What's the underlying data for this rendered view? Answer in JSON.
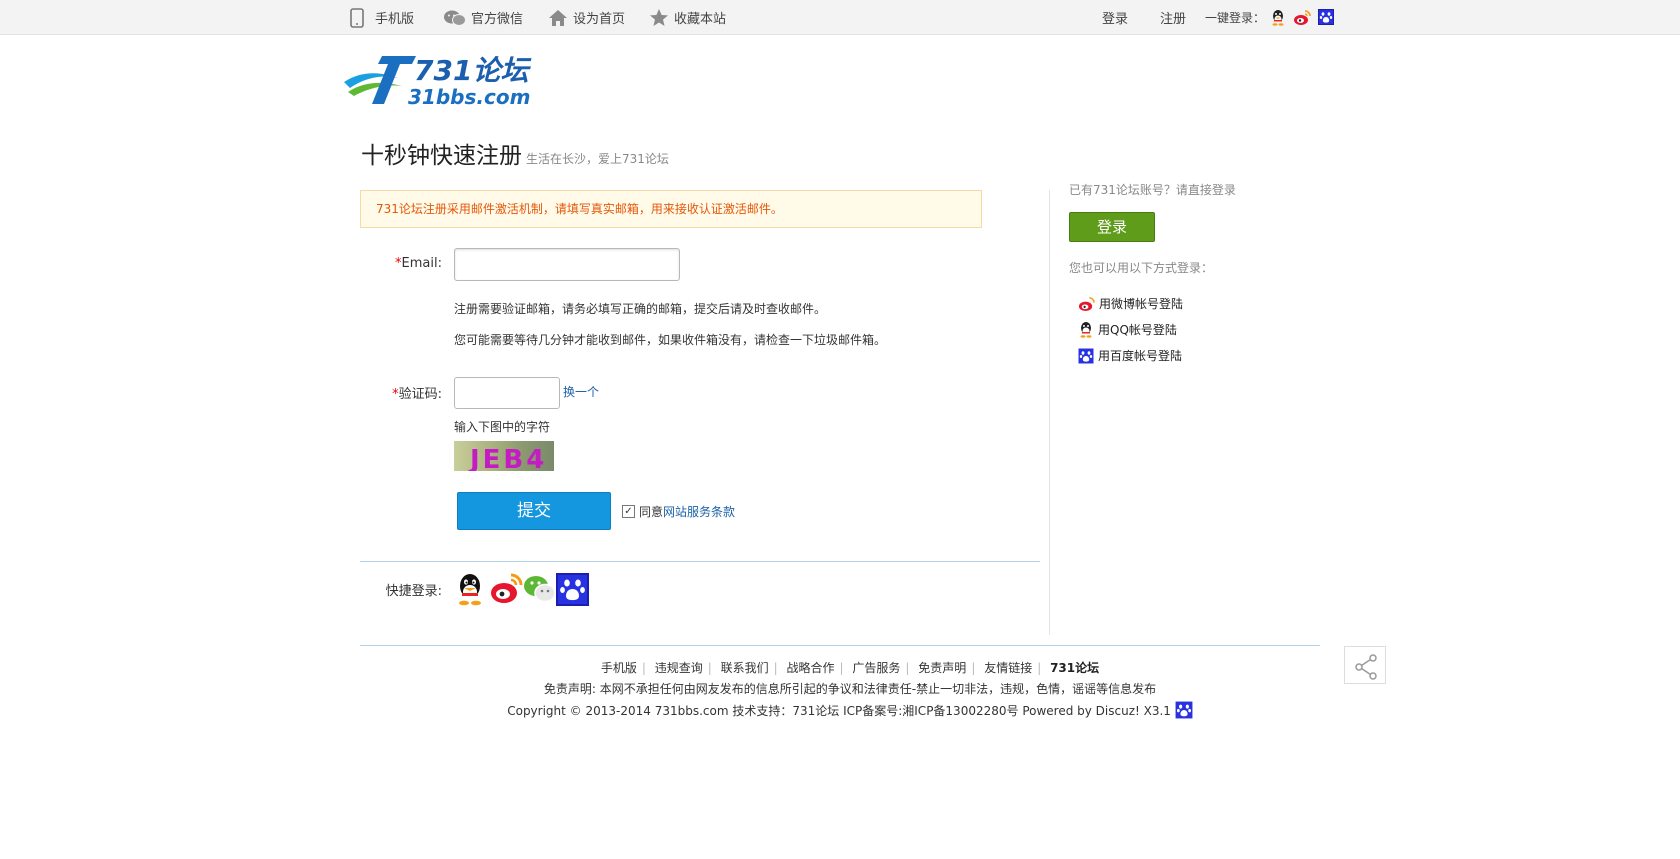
{
  "topbar": {
    "mobile": "手机版",
    "wechat": "官方微信",
    "set_home": "设为首页",
    "bookmark": "收藏本站",
    "login": "登录",
    "register": "注册",
    "one_click": "一键登录："
  },
  "logo": {
    "line1": "731论坛",
    "line2": "31bbs.com"
  },
  "page": {
    "title": "十秒钟快速注册",
    "subtitle": "生活在长沙，爱上731论坛",
    "notice": "731论坛注册采用邮件激活机制，请填写真实邮箱，用来接收认证激活邮件。"
  },
  "form": {
    "email_label": "Email:",
    "email_value": "",
    "email_hint1": "注册需要验证邮箱，请务必填写正确的邮箱，提交后请及时查收邮件。",
    "email_hint2": "您可能需要等待几分钟才能收到邮件，如果收件箱没有，请检查一下垃圾邮件箱。",
    "captcha_label": "验证码:",
    "captcha_value": "",
    "refresh": "换一个",
    "captcha_hint": "输入下图中的字符",
    "captcha_text": "JEB4",
    "submit": "提交",
    "agree_prefix": "同意",
    "agree_link": "网站服务条款",
    "quick_login": "快捷登录:"
  },
  "sidebar": {
    "have_account": "已有731论坛账号？请直接登录",
    "login_button": "登录",
    "other_ways": "您也可以用以下方式登录：",
    "weibo": "用微博帐号登陆",
    "qq": "用QQ帐号登陆",
    "baidu": "用百度帐号登陆"
  },
  "footer": {
    "links": [
      "手机版",
      "违规查询",
      "联系我们",
      "战略合作",
      "广告服务",
      "免责声明",
      "友情链接",
      "731论坛"
    ],
    "disclaimer": "免责声明: 本网不承担任何由网友发布的信息所引起的争议和法律责任-禁止一切非法，违规，色情，谣谣等信息发布",
    "copyright": "Copyright © 2013-2014 731bbs.com 技术支持：731论坛 ICP备案号:湘ICP备13002280号 Powered by Discuz! X3.1"
  }
}
